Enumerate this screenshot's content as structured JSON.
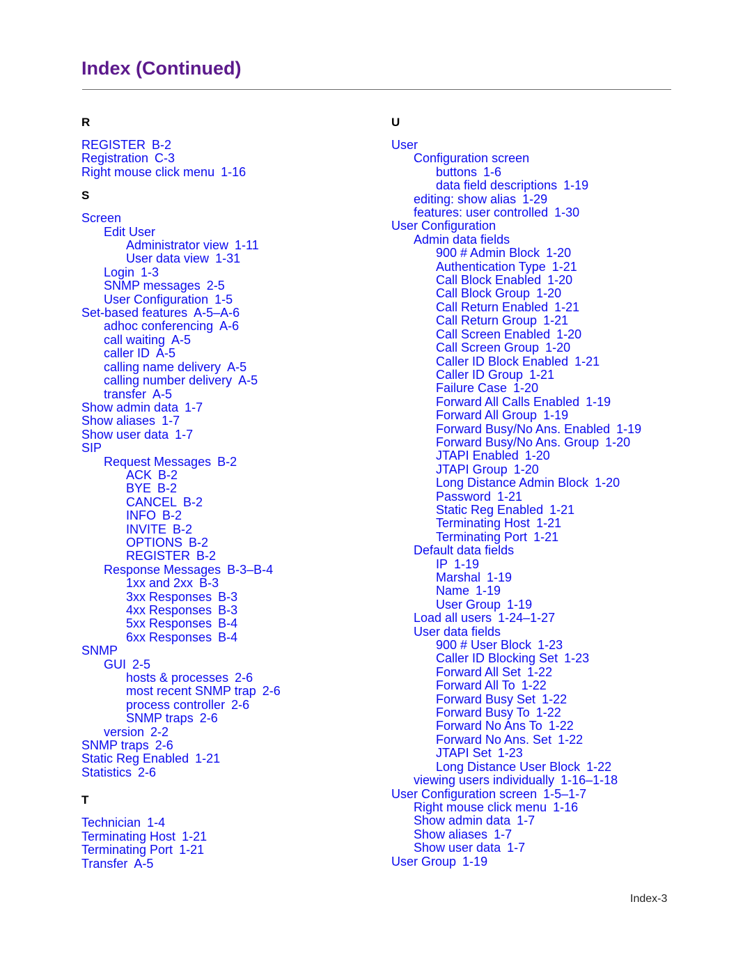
{
  "header": {
    "title": "Index (Continued)"
  },
  "footer": {
    "page_number": "Index-3"
  },
  "colors": {
    "title": "#5c1a8c",
    "link": "#0a0aee",
    "section_letter": "#000000"
  },
  "left_column": {
    "sections": [
      {
        "letter": "R",
        "entries": [
          {
            "level": 0,
            "term": "REGISTER",
            "ref": "B-2"
          },
          {
            "level": 0,
            "term": "Registration",
            "ref": "C-3"
          },
          {
            "level": 0,
            "term": "Right mouse click menu",
            "ref": "1-16"
          }
        ]
      },
      {
        "letter": "S",
        "entries": [
          {
            "level": 0,
            "term": "Screen",
            "ref": ""
          },
          {
            "level": 1,
            "term": "Edit User",
            "ref": ""
          },
          {
            "level": 2,
            "term": "Administrator view",
            "ref": "1-11"
          },
          {
            "level": 2,
            "term": "User data view",
            "ref": "1-31"
          },
          {
            "level": 1,
            "term": "Login",
            "ref": "1-3"
          },
          {
            "level": 1,
            "term": "SNMP messages",
            "ref": "2-5"
          },
          {
            "level": 1,
            "term": "User Configuration",
            "ref": "1-5"
          },
          {
            "level": 0,
            "term": "Set-based features",
            "ref": "A-5–A-6"
          },
          {
            "level": 1,
            "term": "adhoc conferencing",
            "ref": "A-6"
          },
          {
            "level": 1,
            "term": "call waiting",
            "ref": "A-5"
          },
          {
            "level": 1,
            "term": "caller ID",
            "ref": "A-5"
          },
          {
            "level": 1,
            "term": "calling name delivery",
            "ref": "A-5"
          },
          {
            "level": 1,
            "term": "calling number delivery",
            "ref": "A-5"
          },
          {
            "level": 1,
            "term": "transfer",
            "ref": "A-5"
          },
          {
            "level": 0,
            "term": "Show admin data",
            "ref": "1-7"
          },
          {
            "level": 0,
            "term": "Show aliases",
            "ref": "1-7"
          },
          {
            "level": 0,
            "term": "Show user data",
            "ref": "1-7"
          },
          {
            "level": 0,
            "term": "SIP",
            "ref": ""
          },
          {
            "level": 1,
            "term": "Request Messages",
            "ref": "B-2"
          },
          {
            "level": 2,
            "term": "ACK",
            "ref": "B-2"
          },
          {
            "level": 2,
            "term": "BYE",
            "ref": "B-2"
          },
          {
            "level": 2,
            "term": "CANCEL",
            "ref": "B-2"
          },
          {
            "level": 2,
            "term": "INFO",
            "ref": "B-2"
          },
          {
            "level": 2,
            "term": "INVITE",
            "ref": "B-2"
          },
          {
            "level": 2,
            "term": "OPTIONS",
            "ref": "B-2"
          },
          {
            "level": 2,
            "term": "REGISTER",
            "ref": "B-2"
          },
          {
            "level": 1,
            "term": "Response Messages",
            "ref": "B-3–B-4"
          },
          {
            "level": 2,
            "term": "1xx and 2xx",
            "ref": "B-3"
          },
          {
            "level": 2,
            "term": "3xx Responses",
            "ref": "B-3"
          },
          {
            "level": 2,
            "term": "4xx Responses",
            "ref": "B-3"
          },
          {
            "level": 2,
            "term": "5xx Responses",
            "ref": "B-4"
          },
          {
            "level": 2,
            "term": "6xx Responses",
            "ref": "B-4"
          },
          {
            "level": 0,
            "term": "SNMP",
            "ref": ""
          },
          {
            "level": 1,
            "term": "GUI",
            "ref": "2-5"
          },
          {
            "level": 2,
            "term": "hosts & processes",
            "ref": "2-6"
          },
          {
            "level": 2,
            "term": "most recent SNMP trap",
            "ref": "2-6"
          },
          {
            "level": 2,
            "term": "process controller",
            "ref": "2-6"
          },
          {
            "level": 2,
            "term": "SNMP traps",
            "ref": "2-6"
          },
          {
            "level": 1,
            "term": "version",
            "ref": "2-2"
          },
          {
            "level": 0,
            "term": "SNMP traps",
            "ref": "2-6"
          },
          {
            "level": 0,
            "term": "Static Reg Enabled",
            "ref": "1-21"
          },
          {
            "level": 0,
            "term": "Statistics",
            "ref": "2-6"
          }
        ]
      },
      {
        "letter": "T",
        "entries": [
          {
            "level": 0,
            "term": "Technician",
            "ref": "1-4"
          },
          {
            "level": 0,
            "term": "Terminating Host",
            "ref": "1-21"
          },
          {
            "level": 0,
            "term": "Terminating Port",
            "ref": "1-21"
          },
          {
            "level": 0,
            "term": "Transfer",
            "ref": "A-5"
          }
        ]
      }
    ]
  },
  "right_column": {
    "sections": [
      {
        "letter": "U",
        "entries": [
          {
            "level": 0,
            "term": "User",
            "ref": ""
          },
          {
            "level": 1,
            "term": "Configuration screen",
            "ref": ""
          },
          {
            "level": 2,
            "term": "buttons",
            "ref": "1-6"
          },
          {
            "level": 2,
            "term": "data field descriptions",
            "ref": "1-19"
          },
          {
            "level": 1,
            "term": "editing: show alias",
            "ref": "1-29"
          },
          {
            "level": 1,
            "term": "features: user controlled",
            "ref": "1-30"
          },
          {
            "level": 0,
            "term": "User Configuration",
            "ref": ""
          },
          {
            "level": 1,
            "term": "Admin data fields",
            "ref": ""
          },
          {
            "level": 2,
            "term": "900 # Admin Block",
            "ref": "1-20"
          },
          {
            "level": 2,
            "term": "Authentication Type",
            "ref": "1-21"
          },
          {
            "level": 2,
            "term": "Call Block Enabled",
            "ref": "1-20"
          },
          {
            "level": 2,
            "term": "Call Block Group",
            "ref": "1-20"
          },
          {
            "level": 2,
            "term": "Call Return Enabled",
            "ref": "1-21"
          },
          {
            "level": 2,
            "term": "Call Return Group",
            "ref": "1-21"
          },
          {
            "level": 2,
            "term": "Call Screen Enabled",
            "ref": "1-20"
          },
          {
            "level": 2,
            "term": "Call Screen Group",
            "ref": "1-20"
          },
          {
            "level": 2,
            "term": "Caller ID Block Enabled",
            "ref": "1-21"
          },
          {
            "level": 2,
            "term": "Caller ID Group",
            "ref": "1-21"
          },
          {
            "level": 2,
            "term": "Failure Case",
            "ref": "1-20"
          },
          {
            "level": 2,
            "term": "Forward All Calls Enabled",
            "ref": "1-19"
          },
          {
            "level": 2,
            "term": "Forward All Group",
            "ref": "1-19"
          },
          {
            "level": 2,
            "term": "Forward Busy/No Ans. Enabled",
            "ref": "1-19"
          },
          {
            "level": 2,
            "term": "Forward Busy/No Ans. Group",
            "ref": "1-20"
          },
          {
            "level": 2,
            "term": "JTAPI Enabled",
            "ref": "1-20"
          },
          {
            "level": 2,
            "term": "JTAPI Group",
            "ref": "1-20"
          },
          {
            "level": 2,
            "term": "Long Distance Admin Block",
            "ref": "1-20"
          },
          {
            "level": 2,
            "term": "Password",
            "ref": "1-21"
          },
          {
            "level": 2,
            "term": "Static Reg Enabled",
            "ref": "1-21"
          },
          {
            "level": 2,
            "term": "Terminating Host",
            "ref": "1-21"
          },
          {
            "level": 2,
            "term": "Terminating Port",
            "ref": "1-21"
          },
          {
            "level": 1,
            "term": "Default data fields",
            "ref": ""
          },
          {
            "level": 2,
            "term": "IP",
            "ref": "1-19"
          },
          {
            "level": 2,
            "term": "Marshal",
            "ref": "1-19"
          },
          {
            "level": 2,
            "term": "Name",
            "ref": "1-19"
          },
          {
            "level": 2,
            "term": "User Group",
            "ref": "1-19"
          },
          {
            "level": 1,
            "term": "Load all users",
            "ref": "1-24–1-27"
          },
          {
            "level": 1,
            "term": "User data fields",
            "ref": ""
          },
          {
            "level": 2,
            "term": "900 # User Block",
            "ref": "1-23"
          },
          {
            "level": 2,
            "term": "Caller ID Blocking Set",
            "ref": "1-23"
          },
          {
            "level": 2,
            "term": "Forward All Set",
            "ref": "1-22"
          },
          {
            "level": 2,
            "term": "Forward All To",
            "ref": "1-22"
          },
          {
            "level": 2,
            "term": "Forward Busy Set",
            "ref": "1-22"
          },
          {
            "level": 2,
            "term": "Forward Busy To",
            "ref": "1-22"
          },
          {
            "level": 2,
            "term": "Forward No Ans To",
            "ref": "1-22"
          },
          {
            "level": 2,
            "term": "Forward No Ans. Set",
            "ref": "1-22"
          },
          {
            "level": 2,
            "term": "JTAPI Set",
            "ref": "1-23"
          },
          {
            "level": 2,
            "term": "Long Distance User Block",
            "ref": "1-22"
          },
          {
            "level": 1,
            "term": "viewing users individually",
            "ref": "1-16–1-18"
          },
          {
            "level": 0,
            "term": "User Configuration screen",
            "ref": "1-5–1-7"
          },
          {
            "level": 1,
            "term": "Right mouse click menu",
            "ref": "1-16"
          },
          {
            "level": 1,
            "term": "Show admin data",
            "ref": "1-7"
          },
          {
            "level": 1,
            "term": "Show aliases",
            "ref": "1-7"
          },
          {
            "level": 1,
            "term": "Show user data",
            "ref": "1-7"
          },
          {
            "level": 0,
            "term": "User Group",
            "ref": "1-19"
          }
        ]
      }
    ]
  }
}
